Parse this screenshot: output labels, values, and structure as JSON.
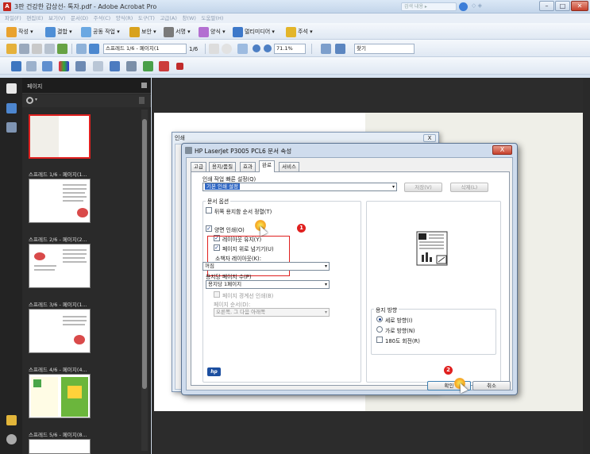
{
  "window": {
    "title": "3판 건강한 갑상선- 톡자.pdf - Adobe Acrobat Pro",
    "search_placeholder": "검색 내용 ▸",
    "right_text": "◇ ◈"
  },
  "menu": [
    "파일(F)",
    "편집(E)",
    "보기(V)",
    "문서(D)",
    "주석(C)",
    "양식(R)",
    "도구(T)",
    "고급(A)",
    "창(W)",
    "도움말(H)"
  ],
  "toolbar1": {
    "create": "작성 ▾",
    "combine": "결합 ▾",
    "collaborate": "공동 작업 ▾",
    "secure": "보안 ▾",
    "sign": "서명 ▾",
    "forms": "양식 ▾",
    "multimedia": "멀티미디어 ▾",
    "comment": "주석 ▾"
  },
  "toolbar2": {
    "page_field": "스프레드 1/6 - 페이지(1",
    "page_count": "1/6",
    "zoom": "71.1%",
    "find_placeholder": "찾기"
  },
  "left_panel": {
    "title": "페이지",
    "thumbnails": [
      {
        "label": ""
      },
      {
        "label": "스프레드 1/6 - 페이지(1..."
      },
      {
        "label": "스프레드 2/6 - 페이지(2..."
      },
      {
        "label": "스프레드 3/6 - 페이지(1..."
      },
      {
        "label": "스프레드 4/6 - 페이지(4..."
      },
      {
        "label": "스프레드 5/6 - 페이지(8..."
      }
    ]
  },
  "print_dialog": {
    "title": "인쇄",
    "close": "X"
  },
  "props_dialog": {
    "title": "HP LaserJet P3005 PCL6 문서 속성",
    "close": "X",
    "tabs": [
      "고급",
      "용지/품질",
      "효과",
      "완료",
      "서비스"
    ],
    "active_tab": "완료",
    "shortcut_label": "인쇄 작업 빠른 설정(Q)",
    "shortcut_value": "기본 인쇄 설정",
    "save_button": "저장(V)",
    "delete_button": "삭제(L)",
    "doc_options_label": "문서 옵션",
    "reverse_order": "뒤쪽 용지함 순서 정렬(T)",
    "duplex": "양면 인쇄(O)",
    "keep_layout": "레이아웃 유지(Y)",
    "flip_up": "페이지 위로 넘기기(U)",
    "booklet_label": "소책자 레이아웃(K):",
    "booklet_value": "꺼짐",
    "pages_per_sheet_label": "용지당 페이지 수(P)",
    "pages_per_sheet_value": "용지당 1페이지",
    "page_borders": "페이지 경계선 인쇄(B)",
    "page_order_label": "페이지 순서(D):",
    "page_order_value": "오른쪽, 그 다음 아래쪽",
    "orientation_label": "용지 방향",
    "portrait": "세로 방향(I)",
    "landscape": "가로 방향(N)",
    "rotate180": "180도 회전(R)",
    "ok_button": "확인",
    "cancel_button": "취소",
    "hp_logo": "hp",
    "step1": "1",
    "step2": "2"
  }
}
